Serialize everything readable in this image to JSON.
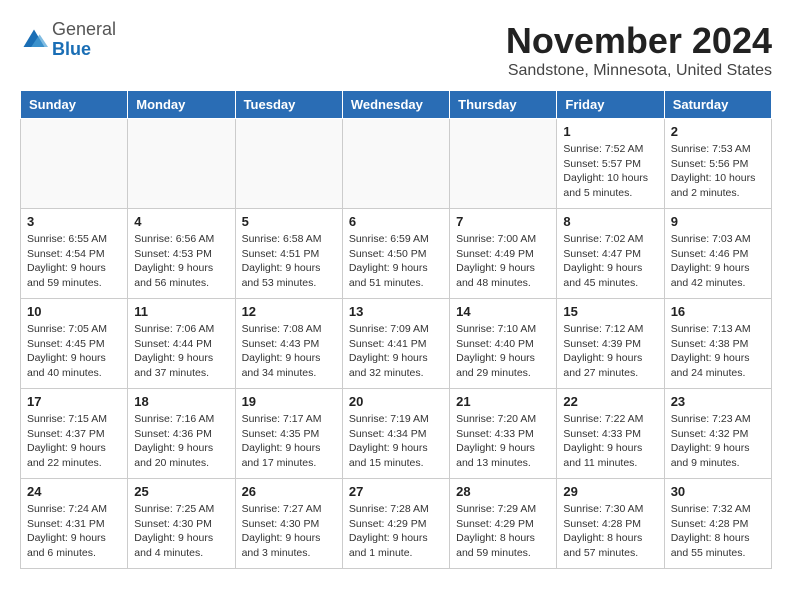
{
  "header": {
    "logo_general": "General",
    "logo_blue": "Blue",
    "month_title": "November 2024",
    "location": "Sandstone, Minnesota, United States"
  },
  "weekdays": [
    "Sunday",
    "Monday",
    "Tuesday",
    "Wednesday",
    "Thursday",
    "Friday",
    "Saturday"
  ],
  "weeks": [
    [
      {
        "day": "",
        "info": ""
      },
      {
        "day": "",
        "info": ""
      },
      {
        "day": "",
        "info": ""
      },
      {
        "day": "",
        "info": ""
      },
      {
        "day": "",
        "info": ""
      },
      {
        "day": "1",
        "info": "Sunrise: 7:52 AM\nSunset: 5:57 PM\nDaylight: 10 hours\nand 5 minutes."
      },
      {
        "day": "2",
        "info": "Sunrise: 7:53 AM\nSunset: 5:56 PM\nDaylight: 10 hours\nand 2 minutes."
      }
    ],
    [
      {
        "day": "3",
        "info": "Sunrise: 6:55 AM\nSunset: 4:54 PM\nDaylight: 9 hours\nand 59 minutes."
      },
      {
        "day": "4",
        "info": "Sunrise: 6:56 AM\nSunset: 4:53 PM\nDaylight: 9 hours\nand 56 minutes."
      },
      {
        "day": "5",
        "info": "Sunrise: 6:58 AM\nSunset: 4:51 PM\nDaylight: 9 hours\nand 53 minutes."
      },
      {
        "day": "6",
        "info": "Sunrise: 6:59 AM\nSunset: 4:50 PM\nDaylight: 9 hours\nand 51 minutes."
      },
      {
        "day": "7",
        "info": "Sunrise: 7:00 AM\nSunset: 4:49 PM\nDaylight: 9 hours\nand 48 minutes."
      },
      {
        "day": "8",
        "info": "Sunrise: 7:02 AM\nSunset: 4:47 PM\nDaylight: 9 hours\nand 45 minutes."
      },
      {
        "day": "9",
        "info": "Sunrise: 7:03 AM\nSunset: 4:46 PM\nDaylight: 9 hours\nand 42 minutes."
      }
    ],
    [
      {
        "day": "10",
        "info": "Sunrise: 7:05 AM\nSunset: 4:45 PM\nDaylight: 9 hours\nand 40 minutes."
      },
      {
        "day": "11",
        "info": "Sunrise: 7:06 AM\nSunset: 4:44 PM\nDaylight: 9 hours\nand 37 minutes."
      },
      {
        "day": "12",
        "info": "Sunrise: 7:08 AM\nSunset: 4:43 PM\nDaylight: 9 hours\nand 34 minutes."
      },
      {
        "day": "13",
        "info": "Sunrise: 7:09 AM\nSunset: 4:41 PM\nDaylight: 9 hours\nand 32 minutes."
      },
      {
        "day": "14",
        "info": "Sunrise: 7:10 AM\nSunset: 4:40 PM\nDaylight: 9 hours\nand 29 minutes."
      },
      {
        "day": "15",
        "info": "Sunrise: 7:12 AM\nSunset: 4:39 PM\nDaylight: 9 hours\nand 27 minutes."
      },
      {
        "day": "16",
        "info": "Sunrise: 7:13 AM\nSunset: 4:38 PM\nDaylight: 9 hours\nand 24 minutes."
      }
    ],
    [
      {
        "day": "17",
        "info": "Sunrise: 7:15 AM\nSunset: 4:37 PM\nDaylight: 9 hours\nand 22 minutes."
      },
      {
        "day": "18",
        "info": "Sunrise: 7:16 AM\nSunset: 4:36 PM\nDaylight: 9 hours\nand 20 minutes."
      },
      {
        "day": "19",
        "info": "Sunrise: 7:17 AM\nSunset: 4:35 PM\nDaylight: 9 hours\nand 17 minutes."
      },
      {
        "day": "20",
        "info": "Sunrise: 7:19 AM\nSunset: 4:34 PM\nDaylight: 9 hours\nand 15 minutes."
      },
      {
        "day": "21",
        "info": "Sunrise: 7:20 AM\nSunset: 4:33 PM\nDaylight: 9 hours\nand 13 minutes."
      },
      {
        "day": "22",
        "info": "Sunrise: 7:22 AM\nSunset: 4:33 PM\nDaylight: 9 hours\nand 11 minutes."
      },
      {
        "day": "23",
        "info": "Sunrise: 7:23 AM\nSunset: 4:32 PM\nDaylight: 9 hours\nand 9 minutes."
      }
    ],
    [
      {
        "day": "24",
        "info": "Sunrise: 7:24 AM\nSunset: 4:31 PM\nDaylight: 9 hours\nand 6 minutes."
      },
      {
        "day": "25",
        "info": "Sunrise: 7:25 AM\nSunset: 4:30 PM\nDaylight: 9 hours\nand 4 minutes."
      },
      {
        "day": "26",
        "info": "Sunrise: 7:27 AM\nSunset: 4:30 PM\nDaylight: 9 hours\nand 3 minutes."
      },
      {
        "day": "27",
        "info": "Sunrise: 7:28 AM\nSunset: 4:29 PM\nDaylight: 9 hours\nand 1 minute."
      },
      {
        "day": "28",
        "info": "Sunrise: 7:29 AM\nSunset: 4:29 PM\nDaylight: 8 hours\nand 59 minutes."
      },
      {
        "day": "29",
        "info": "Sunrise: 7:30 AM\nSunset: 4:28 PM\nDaylight: 8 hours\nand 57 minutes."
      },
      {
        "day": "30",
        "info": "Sunrise: 7:32 AM\nSunset: 4:28 PM\nDaylight: 8 hours\nand 55 minutes."
      }
    ]
  ]
}
